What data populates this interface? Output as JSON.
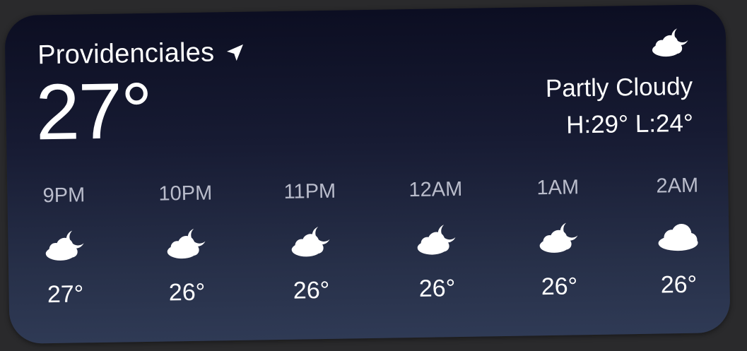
{
  "location": {
    "name": "Providenciales",
    "icon": "location-arrow-icon"
  },
  "current": {
    "temperature": "27°",
    "condition": "Partly Cloudy",
    "high_low": "H:29° L:24°",
    "icon": "partly-cloudy-night-icon"
  },
  "hourly": [
    {
      "time": "9PM",
      "temp": "27°",
      "icon": "partly-cloudy-night-icon"
    },
    {
      "time": "10PM",
      "temp": "26°",
      "icon": "partly-cloudy-night-icon"
    },
    {
      "time": "11PM",
      "temp": "26°",
      "icon": "partly-cloudy-night-icon"
    },
    {
      "time": "12AM",
      "temp": "26°",
      "icon": "partly-cloudy-night-icon"
    },
    {
      "time": "1AM",
      "temp": "26°",
      "icon": "partly-cloudy-night-icon"
    },
    {
      "time": "2AM",
      "temp": "26°",
      "icon": "cloudy-icon"
    }
  ],
  "colors": {
    "gradient_top": "#0c0e22",
    "gradient_bottom": "#2f3a55",
    "hour_label": "#b9bccb",
    "text": "#ffffff"
  }
}
